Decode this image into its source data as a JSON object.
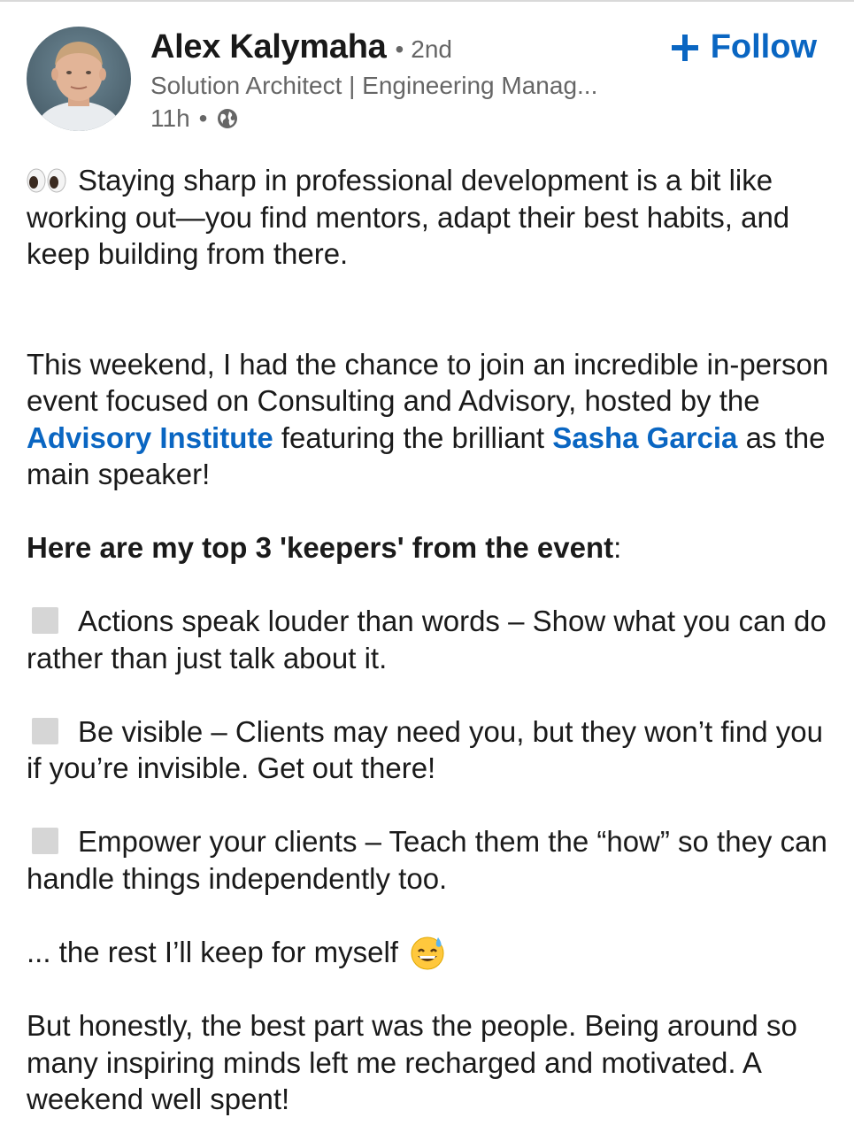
{
  "author": {
    "name": "Alex Kalymaha",
    "separator": "•",
    "degree": "2nd",
    "headline": "Solution Architect | Engineering Manag...",
    "time": "11h",
    "meta_separator": "•",
    "visibility_icon": "globe-icon"
  },
  "follow": {
    "label": "Follow",
    "icon": "plus-icon",
    "color": "#0a66c2"
  },
  "post": {
    "intro": "Staying sharp in professional development is a bit like working out—you find mentors, adapt their best habits, and keep building from there.",
    "intro_icon": "eyes-emoji",
    "event_text_1": "This weekend, I had the chance to join an incredible in-person event focused on Consulting and Advisory, hosted by the",
    "event_link_1": "Advisory Institute",
    "event_text_2": " featuring the brilliant",
    "event_link_2": "Sasha Garcia",
    "event_text_3": "as the main speaker!",
    "keepers_heading": "Here are my top 3 'keepers' from the event",
    "keepers_heading_colon": ":",
    "keepers": [
      "Actions speak louder than words – Show what you can do rather than just talk about it.",
      "Be visible – Clients may need you, but they won’t find you if you’re invisible. Get out there!",
      "Empower your clients – Teach them the “how” so they can handle things independently too."
    ],
    "rest_text": "... the rest I’ll keep for myself",
    "rest_icon": "grinning-sweat-emoji",
    "closing": "But honestly, the best part was the people. Being around so many inspiring minds left me recharged and motivated. A weekend well spent!"
  }
}
